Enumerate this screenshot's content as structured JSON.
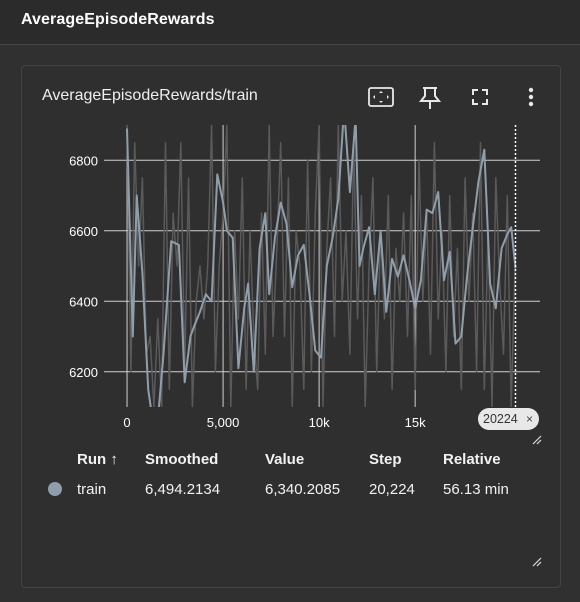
{
  "page_title": "AverageEpisodeRewards",
  "card": {
    "title": "AverageEpisodeRewards/train",
    "step_tag": "20224",
    "step_tag_close": "×"
  },
  "table": {
    "headers": {
      "run": "Run ↑",
      "smoothed": "Smoothed",
      "value": "Value",
      "step": "Step",
      "relative": "Relative"
    },
    "row": {
      "run": "train",
      "smoothed": "6,494.2134",
      "value": "6,340.2085",
      "step": "20,224",
      "relative": "56.13 min",
      "color": "#8f9eab"
    }
  },
  "chart_data": {
    "type": "line",
    "title": "",
    "xlabel": "",
    "ylabel": "",
    "xlim": [
      -1200,
      21500
    ],
    "ylim": [
      6100,
      6900
    ],
    "x_ticks": [
      0,
      5000,
      10000,
      15000
    ],
    "x_tick_labels": [
      "0",
      "5,000",
      "10k",
      "15k"
    ],
    "y_ticks": [
      6200,
      6400,
      6600,
      6800
    ],
    "y_tick_labels": [
      "6200",
      "6400",
      "6600",
      "6800"
    ],
    "grid": true,
    "cursor_step": 20224,
    "series": [
      {
        "role": "raw",
        "color": "#5a5a5a",
        "x": [
          0,
          200,
          400,
          600,
          800,
          1000,
          1200,
          1400,
          1600,
          1800,
          2000,
          2200,
          2400,
          2600,
          2800,
          3000,
          3200,
          3400,
          3600,
          3800,
          4000,
          4200,
          4400,
          4600,
          4800,
          5000,
          5200,
          5400,
          5600,
          5800,
          6000,
          6200,
          6400,
          6600,
          6800,
          7000,
          7200,
          7400,
          7600,
          7800,
          8000,
          8200,
          8400,
          8600,
          8800,
          9000,
          9200,
          9400,
          9600,
          9800,
          10000,
          10200,
          10400,
          10600,
          10800,
          11000,
          11200,
          11400,
          11600,
          11800,
          12000,
          12200,
          12400,
          12600,
          12800,
          13000,
          13200,
          13400,
          13600,
          13800,
          14000,
          14200,
          14400,
          14600,
          14800,
          15000,
          15200,
          15400,
          15600,
          15800,
          16000,
          16200,
          16400,
          16600,
          16800,
          17000,
          17200,
          17400,
          17600,
          17800,
          18000,
          18200,
          18400,
          18600,
          18800,
          19000,
          19200,
          19400,
          19600,
          19800,
          20000,
          20224
        ],
        "values": [
          6900,
          6200,
          6850,
          6500,
          6750,
          6250,
          6300,
          6100,
          6350,
          6100,
          6850,
          6150,
          6650,
          6500,
          6850,
          6200,
          6750,
          6100,
          6400,
          6500,
          6350,
          6500,
          6900,
          6200,
          6500,
          6650,
          6900,
          6100,
          6600,
          6350,
          6750,
          6150,
          6600,
          6300,
          6150,
          6650,
          6250,
          6900,
          6300,
          6550,
          6850,
          6300,
          6750,
          6100,
          6600,
          6500,
          6150,
          6800,
          6200,
          6650,
          6900,
          6100,
          6550,
          6750,
          6300,
          6900,
          6400,
          6600,
          6250,
          6850,
          6350,
          6700,
          6100,
          6500,
          6750,
          6200,
          6600,
          6350,
          6700,
          6150,
          6550,
          6400,
          6650,
          6300,
          6700,
          6150,
          6800,
          6400,
          6650,
          6250,
          6850,
          6350,
          6600,
          6200,
          6700,
          6300,
          6550,
          6150,
          6750,
          6400,
          6650,
          6200,
          6850,
          6150,
          6600,
          6100,
          6750,
          6450,
          6250,
          6700,
          6100,
          6550
        ]
      },
      {
        "role": "smoothed",
        "name": "train",
        "color": "#8f9eab",
        "x": [
          0,
          300,
          500,
          800,
          1100,
          1500,
          1900,
          2300,
          2700,
          3000,
          3300,
          3500,
          3800,
          4100,
          4400,
          4700,
          5000,
          5200,
          5500,
          5800,
          6100,
          6300,
          6600,
          6900,
          7200,
          7400,
          7700,
          8000,
          8300,
          8600,
          8900,
          9200,
          9500,
          9800,
          10100,
          10400,
          10700,
          11000,
          11300,
          11600,
          11900,
          12100,
          12300,
          12600,
          12900,
          13200,
          13500,
          13800,
          14100,
          14400,
          14700,
          15000,
          15300,
          15600,
          15900,
          16200,
          16500,
          16800,
          17100,
          17400,
          17700,
          18000,
          18300,
          18600,
          18900,
          19200,
          19500,
          19800,
          20000,
          20224
        ],
        "values": [
          6890,
          6300,
          6700,
          6480,
          6150,
          6000,
          6250,
          6570,
          6560,
          6170,
          6300,
          6330,
          6370,
          6420,
          6400,
          6760,
          6680,
          6600,
          6580,
          6210,
          6380,
          6450,
          6200,
          6550,
          6650,
          6420,
          6580,
          6680,
          6620,
          6440,
          6530,
          6560,
          6420,
          6260,
          6240,
          6500,
          6580,
          6690,
          6950,
          6710,
          6920,
          6500,
          6550,
          6610,
          6420,
          6600,
          6370,
          6520,
          6470,
          6530,
          6460,
          6380,
          6460,
          6660,
          6650,
          6710,
          6460,
          6540,
          6280,
          6300,
          6470,
          6610,
          6740,
          6830,
          6450,
          6380,
          6550,
          6590,
          6610,
          6494
        ]
      }
    ]
  }
}
